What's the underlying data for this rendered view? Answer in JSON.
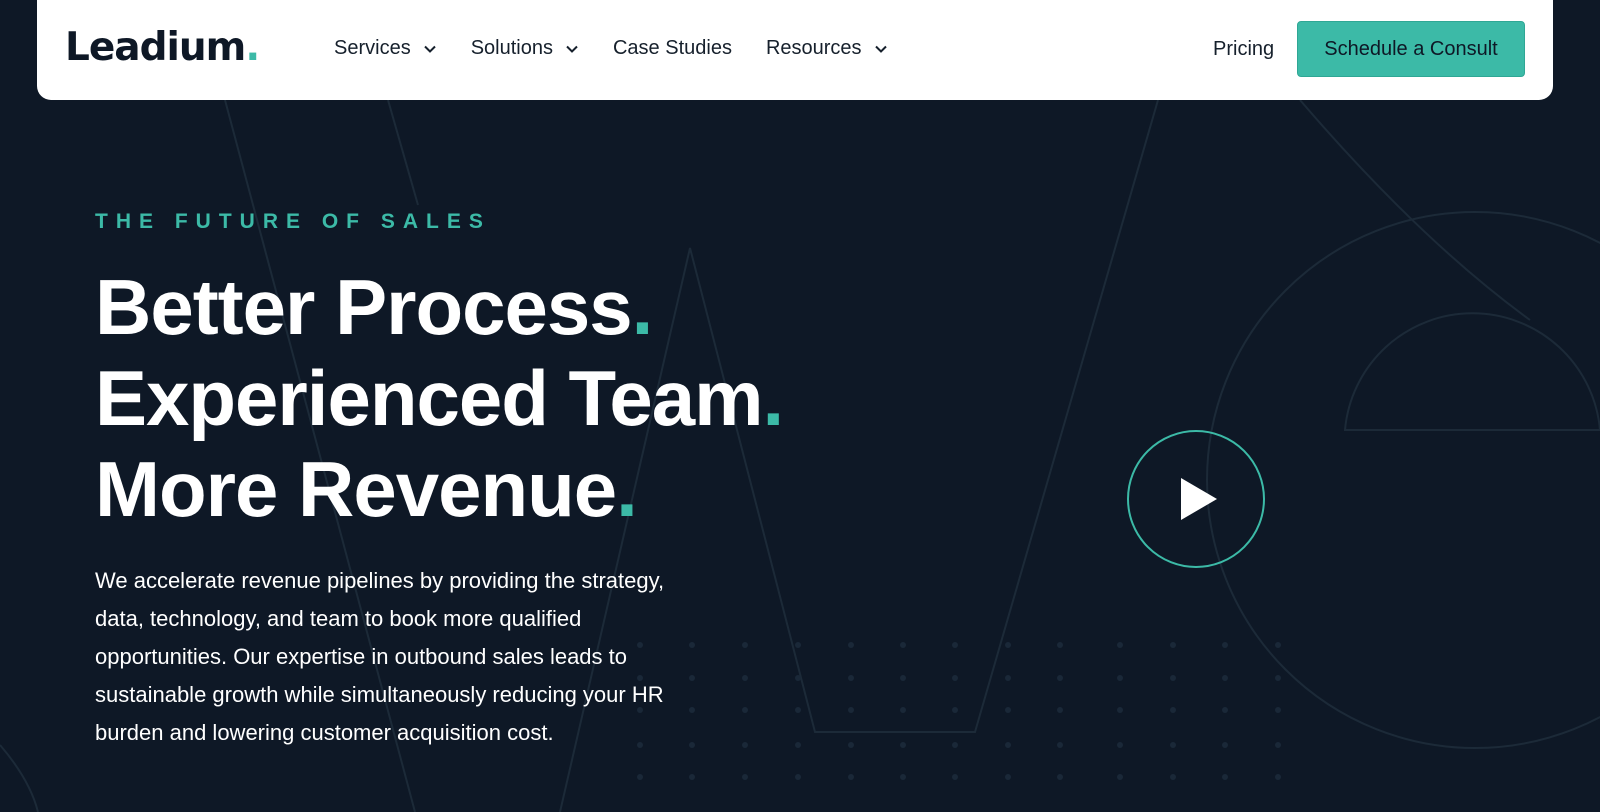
{
  "brand": {
    "name": "Leadium",
    "dot": ".",
    "accent_color": "#3cbaa7",
    "background_color": "#0e1826"
  },
  "nav": {
    "items": [
      {
        "label": "Services",
        "has_dropdown": true
      },
      {
        "label": "Solutions",
        "has_dropdown": true
      },
      {
        "label": "Case Studies",
        "has_dropdown": false
      },
      {
        "label": "Resources",
        "has_dropdown": true
      }
    ],
    "pricing_label": "Pricing",
    "cta_label": "Schedule a Consult"
  },
  "hero": {
    "eyebrow": "THE FUTURE OF SALES",
    "headline": [
      {
        "text": "Better Process",
        "dot": "."
      },
      {
        "text": "Experienced Team",
        "dot": "."
      },
      {
        "text": "More Revenue",
        "dot": "."
      }
    ],
    "description": "We accelerate revenue pipelines by providing the strategy, data, technology, and team to book more qualified opportunities. Our expertise in outbound sales leads to sustainable growth while simultaneously reducing your HR burden and lowering customer acquisition cost.",
    "play_icon": "play-icon"
  }
}
